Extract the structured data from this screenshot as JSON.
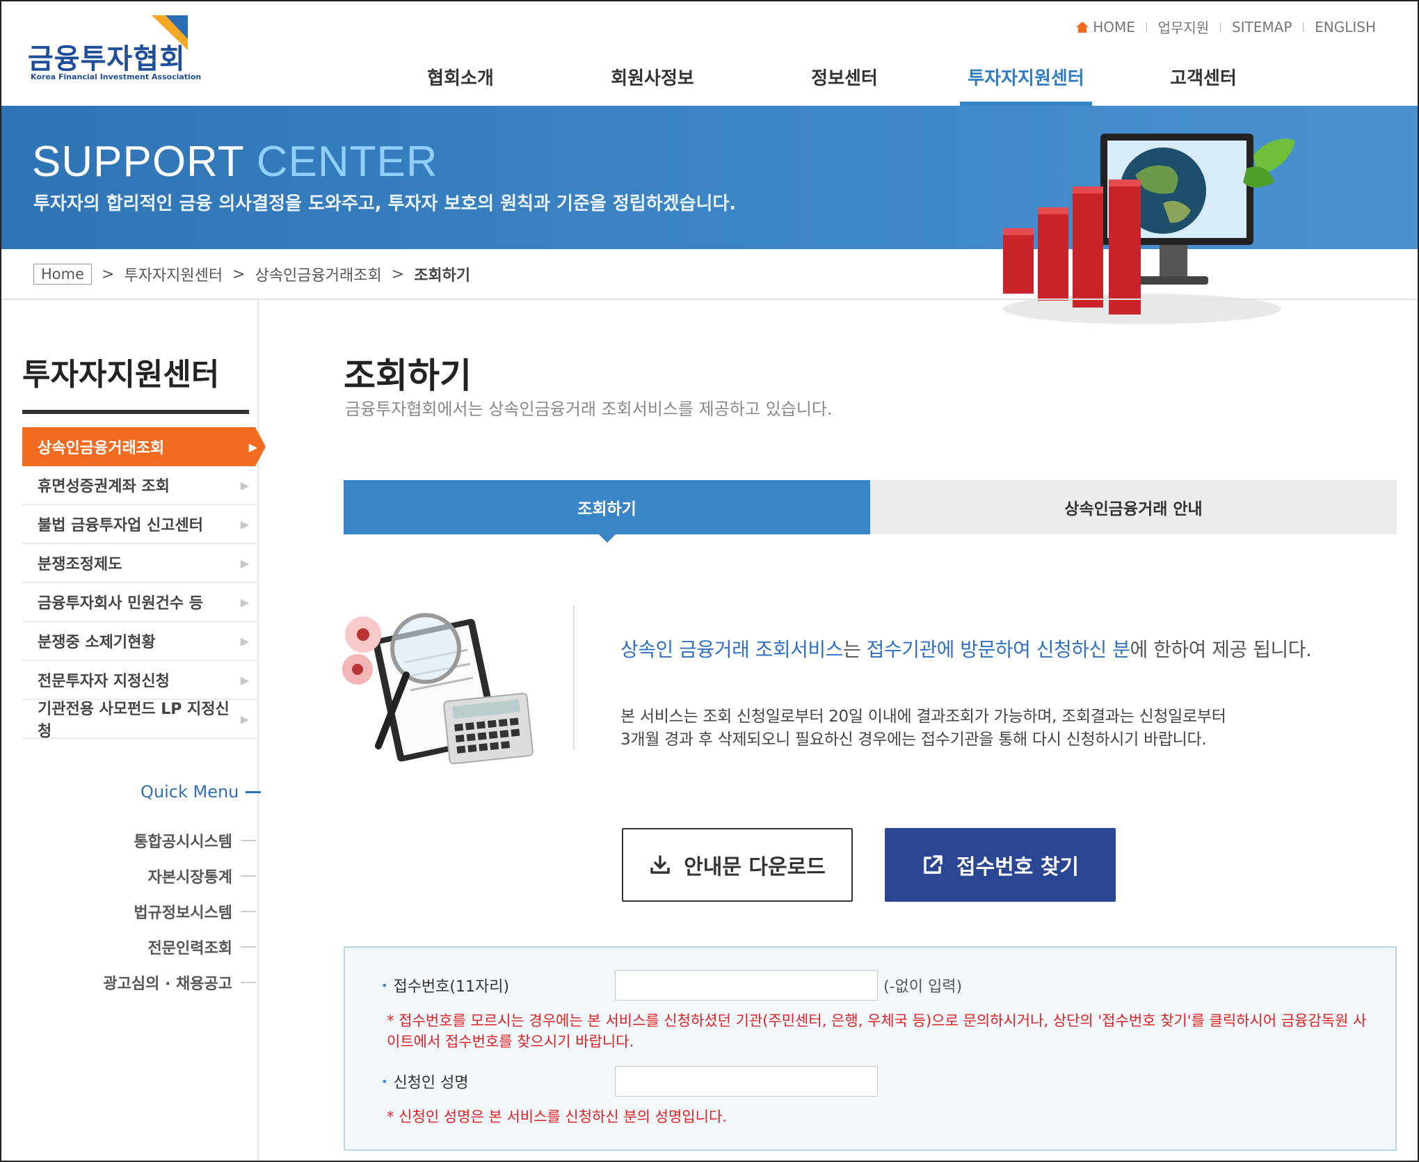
{
  "header": {
    "logo_text": "금융투자협회",
    "logo_sub": "Korea Financial Investment Association",
    "util_links": [
      "HOME",
      "업무지원",
      "SITEMAP",
      "ENGLISH"
    ],
    "nav": [
      "협회소개",
      "회원사정보",
      "정보센터",
      "투자자지원센터",
      "고객센터"
    ],
    "active_nav": "투자자지원센터"
  },
  "banner": {
    "title_main": "SUPPORT ",
    "title_accent": "CENTER",
    "subtitle": "투자자의 합리적인 금융 의사결정을 도와주고, 투자자 보호의 원칙과 기준을 정립하겠습니다."
  },
  "breadcrumb": [
    "Home",
    "투자자지원센터",
    "상속인금융거래조회",
    "조회하기"
  ],
  "sidebar": {
    "title": "투자자지원센터",
    "items": [
      {
        "label": "상속인금융거래조회",
        "active": true
      },
      {
        "label": "휴면성증권계좌 조회"
      },
      {
        "label": "불법 금융투자업 신고센터"
      },
      {
        "label": "분쟁조정제도"
      },
      {
        "label": "금융투자회사 민원건수 등"
      },
      {
        "label": "분쟁중 소제기현황"
      },
      {
        "label": "전문투자자 지정신청"
      },
      {
        "label": "기관전용 사모펀드 LP 지정신청"
      }
    ],
    "quick_menu_title": "Quick Menu",
    "quick_menu": [
      "통합공시시스템",
      "자본시장통계",
      "법규정보시스템",
      "전문인력조회",
      "광고심의 · 채용공고"
    ]
  },
  "content": {
    "title": "조회하기",
    "description": "금융투자협회에서는 상속인금융거래 조회서비스를 제공하고 있습니다.",
    "tabs": [
      "조회하기",
      "상속인금융거래 안내"
    ],
    "info_head": {
      "part1": "상속인 금융거래 조회서비스",
      "part2": "는 ",
      "part3": "접수기관에 방문하여 신청하신 분",
      "part4": "에 한하여 제공 됩니다."
    },
    "info_body_line1": "본 서비스는 조회 신청일로부터 20일 이내에 결과조회가 가능하며, 조회결과는 신청일로부터",
    "info_body_line2": "3개월 경과 후 삭제되오니 필요하신 경우에는 접수기관을 통해 다시 신청하시기 바랍니다.",
    "btn_download": "안내문 다운로드",
    "btn_find": "접수번호 찾기"
  },
  "form": {
    "receipt_label": "접수번호(11자리)",
    "receipt_value": "",
    "receipt_hint": "(-없이 입력)",
    "receipt_note": "* 접수번호를 모르시는 경우에는 본 서비스를 신청하셨던 기관(주민센터, 은행, 우체국 등)으로 문의하시거나, 상단의 '접수번호 찾기'를 클릭하시어 금융감독원 사이트에서 접수번호를 찾으시기 바랍니다.",
    "name_label": "신청인 성명",
    "name_value": "",
    "name_note": "* 신청인 성명은 본 서비스를 신청하신 분의 성명입니다."
  },
  "colors": {
    "brand_blue": "#3a84c8",
    "orange": "#f26b21",
    "navy_button": "#2a4693",
    "note_red": "#e02020"
  }
}
